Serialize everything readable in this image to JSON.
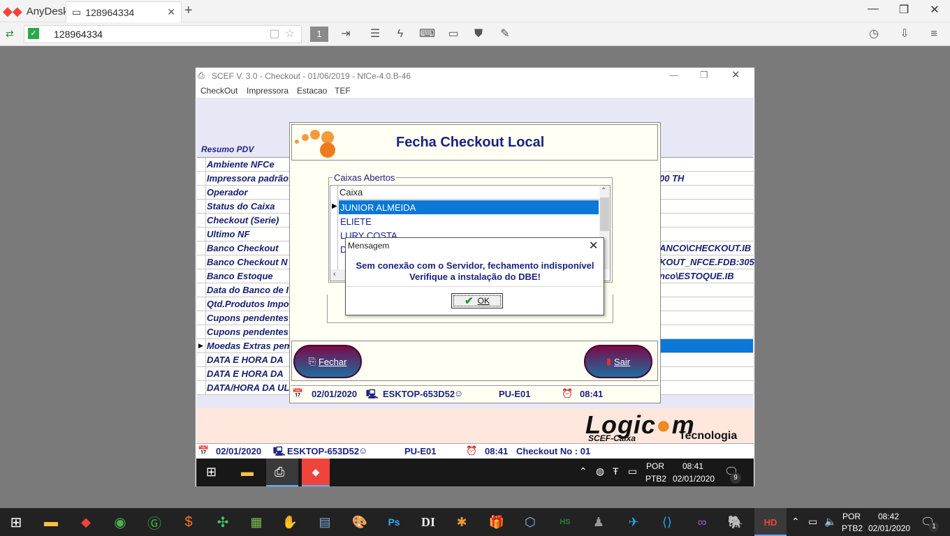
{
  "anydesk": {
    "brand": "AnyDesk",
    "tab_label": "128964334",
    "address_value": "128964334",
    "toolbar_number": "1"
  },
  "scef": {
    "title": "SCEF V.  3.0 - Checkout - 01/06/2019 - NfCe-4.0.B-46",
    "menu": [
      "CheckOut",
      "Impressora",
      "Estacao",
      "TEF"
    ],
    "resumo_label": "Resumo PDV",
    "rows": [
      {
        "label": "Ambiente NFCe",
        "value": ""
      },
      {
        "label": "Impressora padrão",
        "value": "00 TH"
      },
      {
        "label": "Operador",
        "value": ""
      },
      {
        "label": "Status do Caixa",
        "value": ""
      },
      {
        "label": "Checkout (Serie)",
        "value": ""
      },
      {
        "label": "Ultimo NF",
        "value": ""
      },
      {
        "label": "Banco Checkout",
        "value": "ANCO\\CHECKOUT.IB"
      },
      {
        "label": "Banco Checkout N",
        "value": "KOUT_NFCE.FDB:305"
      },
      {
        "label": "Banco Estoque",
        "value": "nco\\ESTOQUE.IB"
      },
      {
        "label": "Data do Banco de I",
        "value": ""
      },
      {
        "label": "Qtd.Produtos Impo",
        "value": ""
      },
      {
        "label": "Cupons pendentes",
        "value": ""
      },
      {
        "label": "Cupons pendentes",
        "value": ""
      },
      {
        "label": "Moedas Extras pen",
        "value": ""
      },
      {
        "label": "DATA E HORA DA",
        "value": ""
      },
      {
        "label": "DATA E HORA DA",
        "value": ""
      },
      {
        "label": "DATA/HORA DA UL",
        "value": ""
      }
    ],
    "logo_main": "Logic",
    "logo_end": "m",
    "logo_sub1": "SCEF-Caixa",
    "logo_sub2": "Tecnologia",
    "status": {
      "date": "02/01/2020",
      "host": "ESKTOP-653D52",
      "station": "PU-E01",
      "time": "08:41",
      "checkout": "Checkout No : 01"
    }
  },
  "fecha": {
    "title": "Fecha Checkout Local",
    "group_label": "Caixas Abertos",
    "column_header": "Caixa",
    "items": [
      "JUNIOR ALMEIDA",
      "ELIETE",
      "LURY COSTA",
      "D"
    ],
    "selected_index": 0,
    "btn_close": "Fechar",
    "btn_exit": "Sair",
    "status": {
      "date": "02/01/2020",
      "host": "ESKTOP-653D52",
      "station": "PU-E01",
      "time": "08:41"
    }
  },
  "message": {
    "title": "Mensagem",
    "line1": "Sem conexão com o Servidor, fechamento indisponível",
    "line2": "Verifique a instalação do DBE!",
    "ok_label": "OK"
  },
  "remote_taskbar": {
    "lang": "POR",
    "layout": "PTB2",
    "time": "08:41",
    "date": "02/01/2020",
    "notif": "9"
  },
  "taskbar": {
    "lang": "POR",
    "layout": "PTB2",
    "time": "08:42",
    "date": "02/01/2020",
    "notif": "1"
  },
  "colors": {
    "selection": "#0a78d7",
    "dark_blue": "#1a237e",
    "anydesk_red": "#ef443b"
  }
}
